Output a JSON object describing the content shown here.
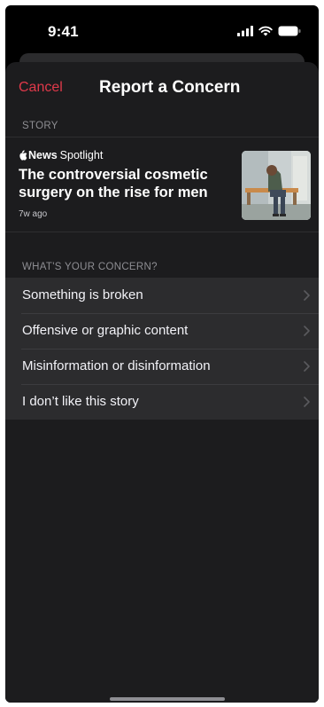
{
  "status_bar": {
    "time": "9:41"
  },
  "nav": {
    "cancel_label": "Cancel",
    "title": "Report a Concern"
  },
  "story_section": {
    "label": "STORY",
    "source_brand": "News",
    "source_sub": "Spotlight",
    "headline": "The controversial cosmetic surgery on the rise for men",
    "age": "7w ago"
  },
  "concern_section": {
    "label": "WHAT'S YOUR CONCERN?",
    "items": [
      {
        "label": "Something is broken"
      },
      {
        "label": "Offensive or graphic content"
      },
      {
        "label": "Misinformation or disinformation"
      },
      {
        "label": "I don’t like this story"
      }
    ]
  },
  "colors": {
    "accent_red": "#e0394a",
    "sheet_bg": "#1c1c1e",
    "list_bg": "#2c2c2e"
  }
}
